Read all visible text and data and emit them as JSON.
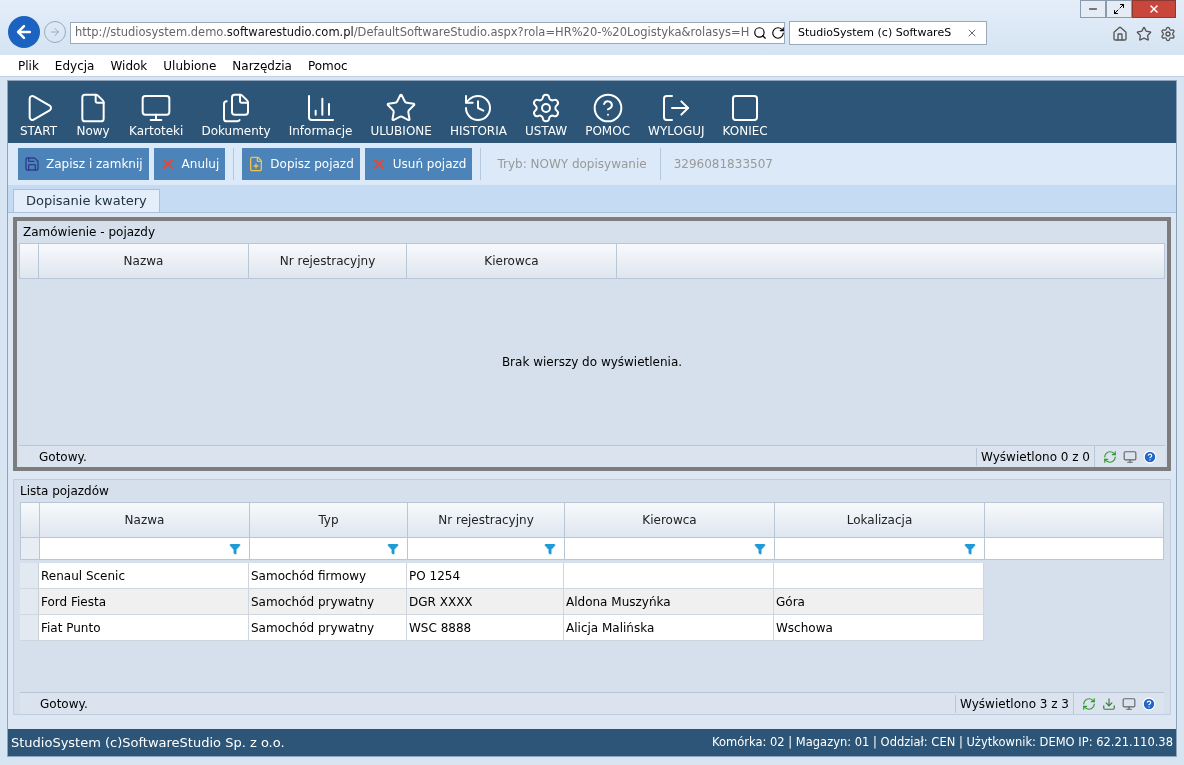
{
  "browser": {
    "address": {
      "prefix": "http://studiosystem.demo.",
      "domain": "softwarestudio.com.pl",
      "path": "/DefaultSoftwareStudio.aspx?rola=HR%20-%20Logistyka&rolasys=H"
    },
    "tab_title": "StudioSystem (c) SoftwareS"
  },
  "menu": [
    "Plik",
    "Edycja",
    "Widok",
    "Ulubione",
    "Narzędzia",
    "Pomoc"
  ],
  "toolbar": [
    {
      "label": "START",
      "kind": "start"
    },
    {
      "label": "Nowy",
      "kind": "new"
    },
    {
      "label": "Kartoteki",
      "kind": "cards"
    },
    {
      "label": "Dokumenty",
      "kind": "documents"
    },
    {
      "label": "Informacje",
      "kind": "info"
    },
    {
      "label": "ULUBIONE",
      "kind": "favorites"
    },
    {
      "label": "HISTORIA",
      "kind": "history"
    },
    {
      "label": "USTAW",
      "kind": "settings"
    },
    {
      "label": "POMOC",
      "kind": "help"
    },
    {
      "label": "WYLOGUJ",
      "kind": "logout"
    },
    {
      "label": "KONIEC",
      "kind": "end"
    }
  ],
  "actions": [
    {
      "label": "Zapisz i zamknij",
      "kind": "save"
    },
    {
      "label": "Anuluj",
      "kind": "cancel"
    },
    {
      "label": "Dopisz pojazd",
      "kind": "add"
    },
    {
      "label": "Usuń pojazd",
      "kind": "cancel"
    }
  ],
  "mode": "Tryb: NOWY dopisywanie",
  "record_id": "3296081833507",
  "tabs": [
    {
      "label": "Dopisanie kwatery",
      "selected": true
    }
  ],
  "orders": {
    "title": "Zamówienie - pojazdy",
    "columns": [
      "Nazwa",
      "Nr rejestracyjny",
      "Kierowca"
    ],
    "empty": "Brak wierszy do wyświetlenia.",
    "status": "Gotowy.",
    "count": "Wyświetlono 0 z 0"
  },
  "vehicles": {
    "title": "Lista pojazdów",
    "columns": [
      "Nazwa",
      "Typ",
      "Nr rejestracyjny",
      "Kierowca",
      "Lokalizacja"
    ],
    "rows": [
      {
        "cells": [
          "Renaul Scenic",
          "Samochód firmowy",
          "PO 1254"
        ]
      },
      {
        "cells": [
          "Ford Fiesta",
          "Samochód prywatny",
          "DGR XXXX",
          "Aldona Muszyńka",
          "Góra"
        ]
      },
      {
        "cells": [
          "Fiat Punto",
          "Samochód prywatny",
          "WSC 8888",
          "Alicja Malińska",
          "Wschowa"
        ]
      }
    ],
    "status": "Gotowy.",
    "count": "Wyświetlono 3 z 3"
  },
  "status_bar": {
    "left": "StudioSystem (c)SoftwareStudio Sp. z o.o.",
    "right": "Komórka: 02 | Magazyn: 01 | Oddział: CEN | Użytkownik: DEMO IP: 62.21.110.38"
  }
}
